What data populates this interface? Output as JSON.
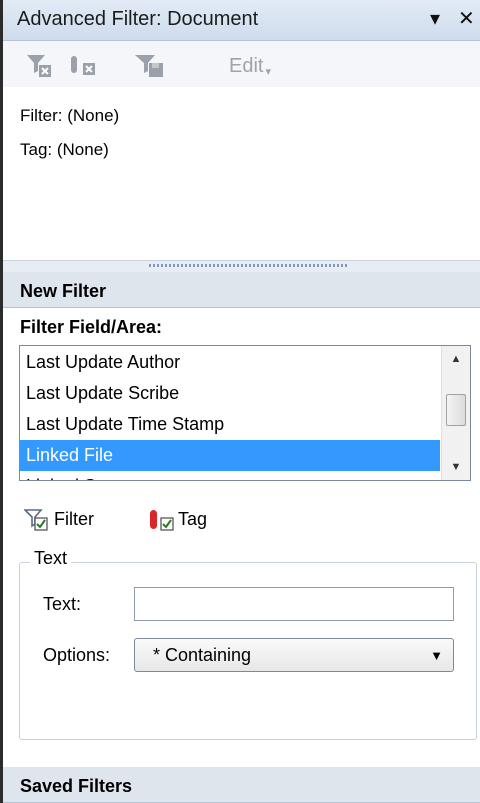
{
  "window": {
    "title": "Advanced Filter:  Document",
    "menu_glyph": "▾",
    "close_glyph": "✕"
  },
  "toolbar": {
    "edit_label": "Edit",
    "edit_arrow": "▾"
  },
  "current": {
    "filter_line": "Filter: (None)",
    "tag_line": "Tag: (None)"
  },
  "new_filter": {
    "heading": "New Filter",
    "field_area_label": "Filter Field/Area:",
    "items": [
      "Last Update Author",
      "Last Update Scribe",
      "Last Update Time Stamp",
      "Linked File",
      "Linked Scans"
    ],
    "selected_index": 3,
    "filter_label": "Filter",
    "tag_label": "Tag"
  },
  "text_group": {
    "legend": "Text",
    "text_label": "Text:",
    "text_value": "",
    "options_label": "Options:",
    "options_value": "* Containing"
  },
  "saved": {
    "heading": "Saved Filters"
  },
  "colors": {
    "selection": "#3399ff",
    "header_bg": "#dfe5ed",
    "titlebar_bg": "#dbe5f2"
  }
}
